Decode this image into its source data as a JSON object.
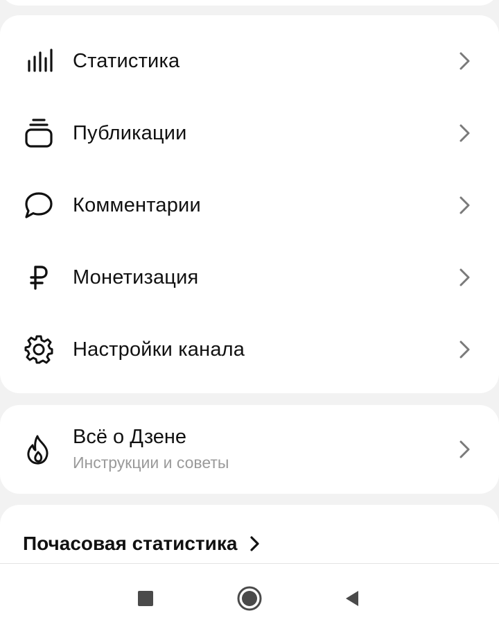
{
  "menu": {
    "items": [
      {
        "label": "Статистика",
        "icon": "bar-chart-icon"
      },
      {
        "label": "Публикации",
        "icon": "stack-icon"
      },
      {
        "label": "Комментарии",
        "icon": "comment-icon"
      },
      {
        "label": "Монетизация",
        "icon": "ruble-icon"
      },
      {
        "label": "Настройки канала",
        "icon": "gear-icon"
      }
    ]
  },
  "zen": {
    "title": "Всё о Дзене",
    "subtitle": "Инструкции и советы",
    "icon": "flame-icon"
  },
  "hourly": {
    "title": "Почасовая статистика"
  },
  "navbar": {
    "buttons": [
      "recents-square-icon",
      "home-circle-icon",
      "back-triangle-icon"
    ]
  },
  "colors": {
    "background": "#f2f2f2",
    "card": "#ffffff",
    "text": "#111111",
    "muted": "#9a9a9a",
    "chevron": "#7a7a7a"
  }
}
